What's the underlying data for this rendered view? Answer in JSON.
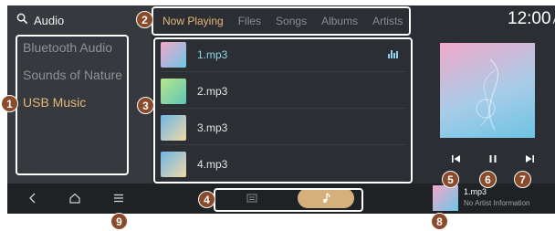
{
  "source_panel": {
    "title": "Audio",
    "items": [
      {
        "label": "Bluetooth Audio",
        "active": false
      },
      {
        "label": "Sounds of Nature",
        "active": false
      },
      {
        "label": "USB Music",
        "active": true
      }
    ]
  },
  "tabs": [
    {
      "label": "Now Playing",
      "active": true
    },
    {
      "label": "Files",
      "active": false
    },
    {
      "label": "Songs",
      "active": false
    },
    {
      "label": "Albums",
      "active": false
    },
    {
      "label": "Artists",
      "active": false
    }
  ],
  "songs": [
    {
      "name": "1.mp3",
      "playing": true
    },
    {
      "name": "2.mp3",
      "playing": false
    },
    {
      "name": "3.mp3",
      "playing": false
    },
    {
      "name": "4.mp3",
      "playing": false
    }
  ],
  "clock": {
    "time": "12:00",
    "ampm": "AM"
  },
  "now_playing": {
    "title": "1.mp3",
    "artist": "No Artist Information"
  },
  "controls": [
    "previous-icon",
    "pause-icon",
    "next-icon"
  ],
  "bottom_nav": [
    "back-icon",
    "home-icon",
    "menu-icon"
  ],
  "mode_toggle": [
    "list-mode-icon",
    "music-mode-icon"
  ],
  "callouts": [
    "1",
    "2",
    "3",
    "4",
    "5",
    "6",
    "7",
    "8",
    "9"
  ],
  "colors": {
    "accent_gold": "#e4b77a",
    "accent_blue": "#8fd1e8",
    "callout": "#8a4b2a"
  }
}
